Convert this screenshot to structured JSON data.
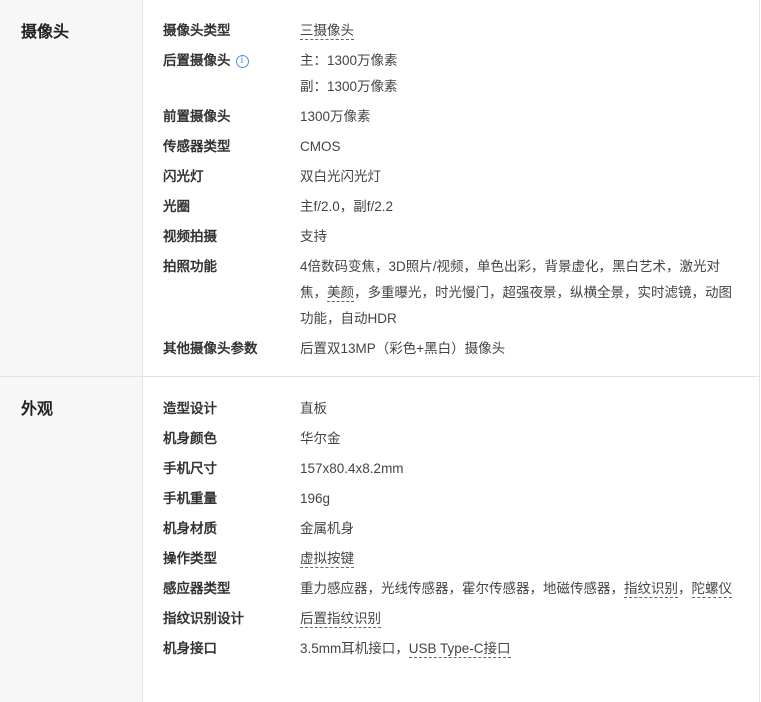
{
  "camera": {
    "title": "摄像头",
    "camera_type_label": "摄像头类型",
    "camera_type_value": "三摄像头",
    "rear_label": "后置摄像头",
    "rear_main": "主：1300万像素",
    "rear_sub": "副：1300万像素",
    "front_label": "前置摄像头",
    "front_value": "1300万像素",
    "sensor_type_label": "传感器类型",
    "sensor_type_value": "CMOS",
    "flash_label": "闪光灯",
    "flash_value": "双白光闪光灯",
    "aperture_label": "光圈",
    "aperture_value": "主f/2.0，副f/2.2",
    "video_label": "视频拍摄",
    "video_value": "支持",
    "features_label": "拍照功能",
    "features_p1": "4倍数码变焦，3D照片/视频，单色出彩，背景虚化，黑白艺术，激光对焦，",
    "features_link": "美颜",
    "features_p2": "，多重曝光，时光慢门，超强夜景，纵横全景，实时滤镜，动图功能，自动HDR",
    "other_label": "其他摄像头参数",
    "other_value": "后置双13MP（彩色+黑白）摄像头"
  },
  "appearance": {
    "title": "外观",
    "design_label": "造型设计",
    "design_value": "直板",
    "color_label": "机身颜色",
    "color_value": "华尔金",
    "size_label": "手机尺寸",
    "size_value": "157x80.4x8.2mm",
    "weight_label": "手机重量",
    "weight_value": "196g",
    "material_label": "机身材质",
    "material_value": "金属机身",
    "operation_label": "操作类型",
    "operation_value": "虚拟按键",
    "sensors_label": "感应器类型",
    "sensors_p1": "重力感应器，光线传感器，霍尔传感器，地磁传感器，",
    "sensors_link1": "指纹识别",
    "sensors_sep": "，",
    "sensors_link2": "陀螺仪",
    "fingerprint_label": "指纹识别设计",
    "fingerprint_value": "后置指纹识别",
    "ports_label": "机身接口",
    "ports_p1": "3.5mm耳机接口，",
    "ports_link": "USB Type-C接口"
  },
  "icons": {
    "info": "info-icon"
  },
  "colors": {
    "header_bg": "#f7f7f7",
    "border": "#e3e3e3",
    "info_blue": "#4a90e2"
  }
}
